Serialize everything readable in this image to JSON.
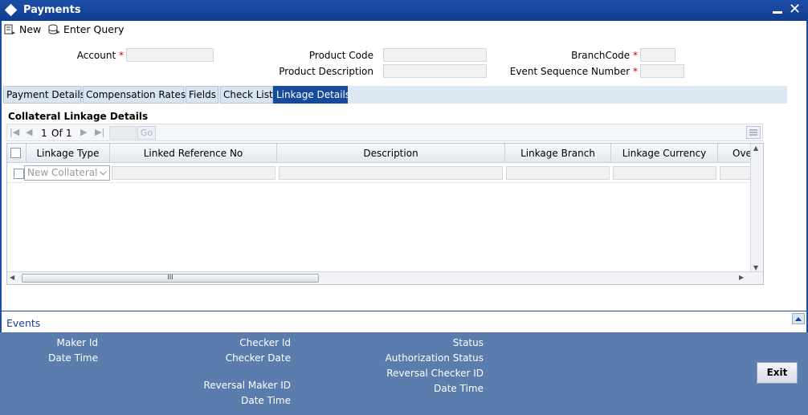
{
  "window": {
    "title": "Payments"
  },
  "toolbar": {
    "new_label": "New",
    "enter_query_label": "Enter Query"
  },
  "header_fields": {
    "account_label": "Account",
    "product_code_label": "Product Code",
    "product_description_label": "Product Description",
    "branch_code_label": "BranchCode",
    "event_sequence_label": "Event Sequence Number",
    "required_marker": "*"
  },
  "tabs": [
    {
      "label": "Payment Details"
    },
    {
      "label": "Compensation Rates"
    },
    {
      "label": "Fields"
    },
    {
      "label": "Check List"
    },
    {
      "label": "Linkage Details"
    }
  ],
  "section": {
    "title": "Collateral Linkage Details"
  },
  "pager": {
    "page": "1",
    "of_label": "Of",
    "total": "1",
    "go_label": "Go"
  },
  "grid": {
    "columns": [
      "Linkage Type",
      "Linked Reference No",
      "Description",
      "Linkage Branch",
      "Linkage Currency",
      "Ove"
    ],
    "row_select_value": "New Collateral",
    "hscroll_grip": "III"
  },
  "events": {
    "label": "Events"
  },
  "footer": {
    "maker_id": "Maker Id",
    "date_time_1": "Date Time",
    "checker_id": "Checker Id",
    "checker_date": "Checker Date",
    "reversal_maker_id": "Reversal Maker ID",
    "date_time_2": "Date Time",
    "status": "Status",
    "authorization_status": "Authorization Status",
    "reversal_checker_id": "Reversal Checker ID",
    "date_time_3": "Date Time",
    "exit_label": "Exit"
  },
  "colors": {
    "title_bar": "#1d4ea7",
    "active_tab": "#164a9c",
    "footer": "#5a7dad",
    "required": "#cc0000"
  }
}
